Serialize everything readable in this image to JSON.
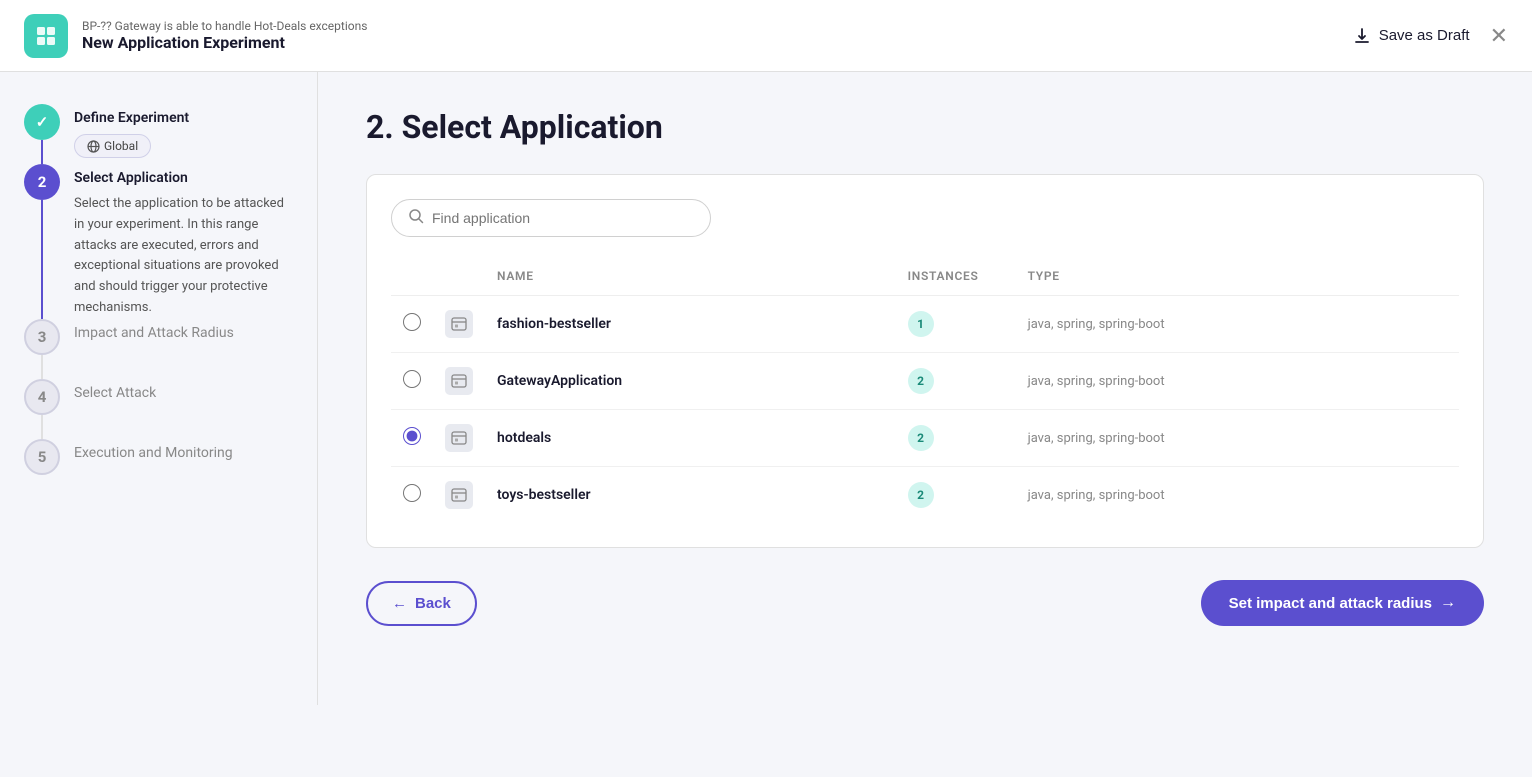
{
  "header": {
    "icon": "⊞",
    "subtitle": "BP-?? Gateway is able to handle Hot-Deals exceptions",
    "title": "New Application Experiment",
    "save_draft_label": "Save as Draft",
    "close_icon": "✕"
  },
  "sidebar": {
    "steps": [
      {
        "number": "✓",
        "state": "done",
        "label": "Define Experiment",
        "sub_badge": "Global",
        "description": null
      },
      {
        "number": "2",
        "state": "active",
        "label": "Select Application",
        "description": "Select the application to be attacked in your experiment. In this range attacks are executed, errors and exceptional situations are provoked and should trigger your protective mechanisms."
      },
      {
        "number": "3",
        "state": "inactive",
        "label": "Impact and Attack Radius",
        "description": null
      },
      {
        "number": "4",
        "state": "inactive",
        "label": "Select Attack",
        "description": null
      },
      {
        "number": "5",
        "state": "inactive",
        "label": "Execution and Monitoring",
        "description": null
      }
    ]
  },
  "main": {
    "page_title": "2. Select Application",
    "search_placeholder": "Find application",
    "table": {
      "columns": [
        "NAME",
        "INSTANCES",
        "TYPE"
      ],
      "rows": [
        {
          "name": "fashion-bestseller",
          "instances": "1",
          "type": "java, spring, spring-boot",
          "selected": false
        },
        {
          "name": "GatewayApplication",
          "instances": "2",
          "type": "java, spring, spring-boot",
          "selected": false
        },
        {
          "name": "hotdeals",
          "instances": "2",
          "type": "java, spring, spring-boot",
          "selected": true
        },
        {
          "name": "toys-bestseller",
          "instances": "2",
          "type": "java, spring, spring-boot",
          "selected": false
        }
      ]
    },
    "back_label": "Back",
    "next_label": "Set impact and attack radius"
  }
}
